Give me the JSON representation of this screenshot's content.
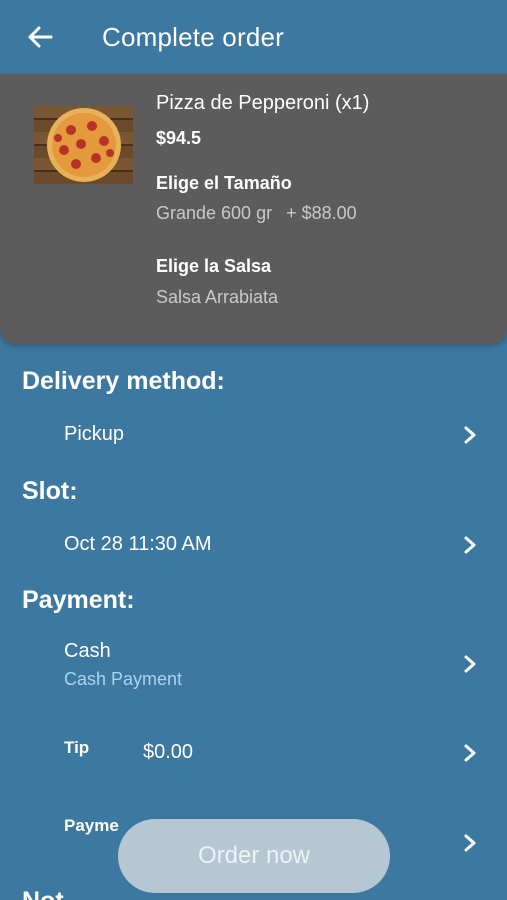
{
  "header": {
    "title": "Complete order",
    "back_icon": "arrow-left-icon"
  },
  "order_item": {
    "name": "Pizza de Pepperoni (x1)",
    "price": "$94.5",
    "options": [
      {
        "title": "Elige el Tamaño",
        "value": "Grande 600 gr",
        "extra": "+ $88.00"
      },
      {
        "title": "Elige la Salsa",
        "value": "Salsa Arrabiata",
        "extra": ""
      }
    ]
  },
  "delivery": {
    "title": "Delivery method:",
    "value": "Pickup"
  },
  "slot": {
    "title": "Slot:",
    "value": "Oct 28 11:30 AM"
  },
  "payment": {
    "title": "Payment:",
    "method": "Cash",
    "method_detail": "Cash Payment",
    "tip_label": "Tip",
    "tip_value": "$0.00",
    "payment_label": "Payme"
  },
  "notes": {
    "title": "Not"
  },
  "order_button": "Order now",
  "colors": {
    "background": "#3d78a0",
    "card": "#5c5c5c",
    "accent_text": "#a9d3f0",
    "button": "#b4c7d3"
  }
}
